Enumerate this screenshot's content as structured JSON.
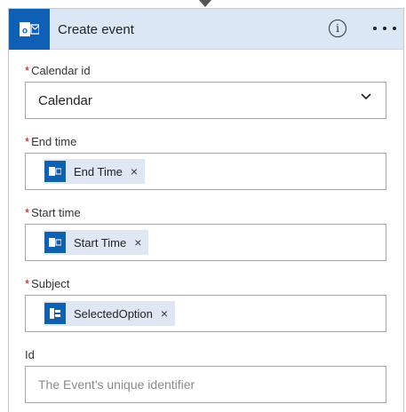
{
  "header": {
    "title": "Create event",
    "app_icon": "outlook-icon",
    "info_icon": "info-icon",
    "more_icon": "more-dots-icon"
  },
  "fields": {
    "calendar_id": {
      "label": "Calendar id",
      "required": "*",
      "value": "Calendar"
    },
    "end_time": {
      "label": "End time",
      "required": "*",
      "token": "End Time"
    },
    "start_time": {
      "label": "Start time",
      "required": "*",
      "token": "Start Time"
    },
    "subject": {
      "label": "Subject",
      "required": "*",
      "token": "SelectedOption"
    },
    "id": {
      "label": "Id",
      "placeholder": "The Event's unique identifier"
    }
  },
  "token_close": "×",
  "colors": {
    "accent": "#0f5fb5",
    "header_bg": "#dbe7f4",
    "required": "#cc0000",
    "token_bg": "#dfe8f2"
  }
}
